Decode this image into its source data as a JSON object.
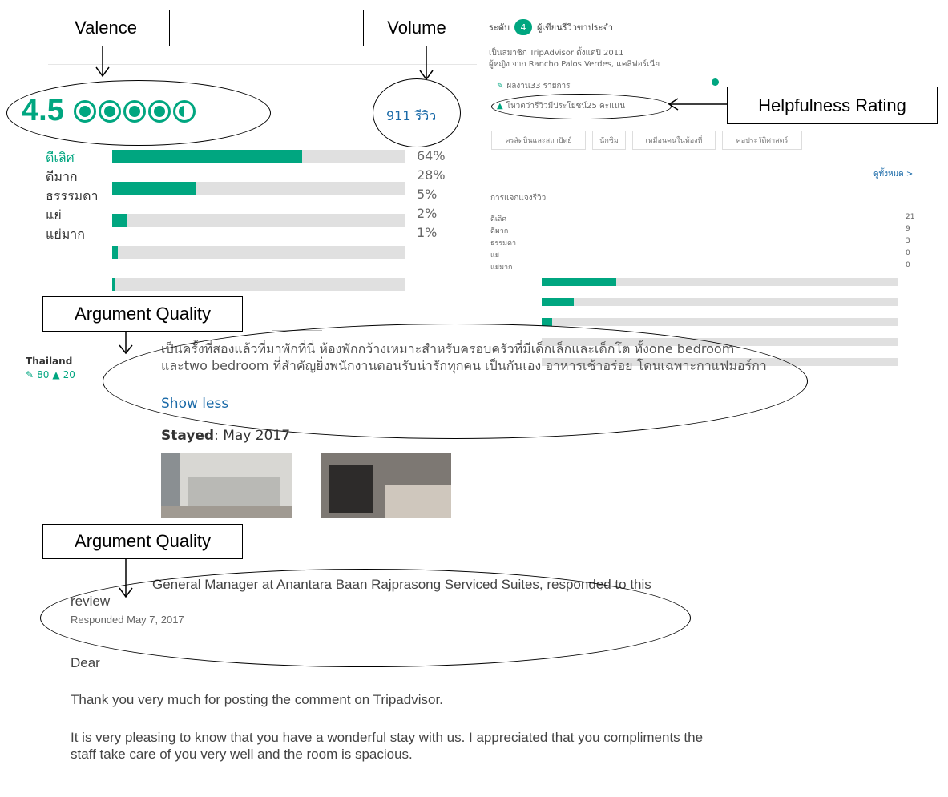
{
  "callouts": {
    "valence": "Valence",
    "volume": "Volume",
    "helpfulness": "Helpfulness Rating",
    "argument_quality_1": "Argument Quality",
    "argument_quality_2": "Argument Quality"
  },
  "rating_summary": {
    "score": "4.5",
    "bubbles_filled": 4.5,
    "review_count": "911 รีวิว",
    "rows": [
      {
        "label": "ดีเลิศ",
        "pct": "64%",
        "value": 0.64
      },
      {
        "label": "ดีมาก",
        "pct": "28%",
        "value": 0.28
      },
      {
        "label": "ธรรรมดา",
        "pct": "5%",
        "value": 0.05
      },
      {
        "label": "แย่",
        "pct": "2%",
        "value": 0.02
      },
      {
        "label": "แย่มาก",
        "pct": "1%",
        "value": 0.01
      }
    ]
  },
  "reviewer": {
    "level_label": "ระดับ",
    "level_number": "4",
    "level_title": "ผู้เขียนรีวิวขาประจำ",
    "member_since": "เป็นสมาชิก TripAdvisor ตั้งแต่ปี 2011",
    "from": "ผู้หญิง จาก Rancho Palos Verdes, แคลิฟอร์เนีย",
    "contributions": "ผลงาน33 รายการ",
    "helpful_votes": "โหวตว่ารีวิวมีประโยชน์25 คะแนน",
    "tags": [
      "ครลัดบินและสถาปัตย์",
      "นักชิม",
      "เหมือนคนในท้องที่",
      "คอประวัติศาสตร์"
    ],
    "see_all": "ดูทั้งหมด >",
    "distribution_title": "การแจกแจงรีวิว",
    "distribution": [
      {
        "label": "ดีเลิศ",
        "count": "21",
        "value": 21
      },
      {
        "label": "ดีมาก",
        "count": "9",
        "value": 9
      },
      {
        "label": "ธรรมดา",
        "count": "3",
        "value": 3
      },
      {
        "label": "แย่",
        "count": "0",
        "value": 0
      },
      {
        "label": "แย่มาก",
        "count": "0",
        "value": 0
      }
    ]
  },
  "review": {
    "country": "Thailand",
    "stats_reviews": "80",
    "stats_helpful": "20",
    "text": "เป็นครั้งที่สองแล้วที่มาพักที่นี่ ห้องพักกว้างเหมาะสำหรับครอบครัวที่มีเด็กเล็กและเด็กโต ทั้งone bedroom และtwo bedroom ที่สำคัญยิ่งพนักงานตอนรับน่ารักทุกคน เป็นกันเอง อาหารเช้าอร่อย โดนเฉพาะกาแฟมอร์กา",
    "show_less": "Show less",
    "stayed_label": "Stayed",
    "stayed_value": ": May 2017"
  },
  "response": {
    "header": "General Manager at Anantara Baan Rajprasong Serviced Suites, responded to this review",
    "date": "Responded May 7, 2017",
    "greeting": "Dear",
    "para1": "Thank you very much for posting the comment on Tripadvisor.",
    "para2": "It is very pleasing to know that you have a wonderful stay with us. I appreciated that you compliments the staff take care of you very well and the room is spacious."
  }
}
